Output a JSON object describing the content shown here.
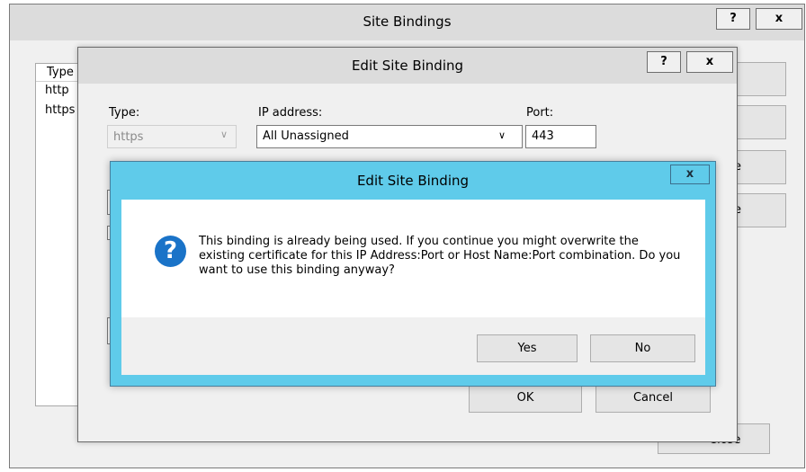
{
  "site_bindings": {
    "title": "Site Bindings",
    "help_label": "?",
    "close_label": "x",
    "list": {
      "header": "Type",
      "rows": [
        "http",
        "https"
      ]
    },
    "side_buttons": {
      "add": "",
      "edit": "",
      "remove": "e",
      "browse": "e"
    },
    "close_button_label": "Close"
  },
  "edit_binding": {
    "title": "Edit Site Binding",
    "help_label": "?",
    "close_label": "x",
    "type_label": "Type:",
    "type_value": "https",
    "ip_label": "IP address:",
    "ip_value": "All Unassigned",
    "port_label": "Port:",
    "port_value": "443",
    "ok_label": "OK",
    "cancel_label": "Cancel"
  },
  "confirm": {
    "title": "Edit Site Binding",
    "close_label": "x",
    "icon_glyph": "?",
    "message": "This binding is already being used. If you continue you might overwrite the existing certificate for this IP Address:Port or Host Name:Port combination. Do you want to use this binding anyway?",
    "yes_label": "Yes",
    "no_label": "No",
    "accent_color": "#5fcbea"
  }
}
